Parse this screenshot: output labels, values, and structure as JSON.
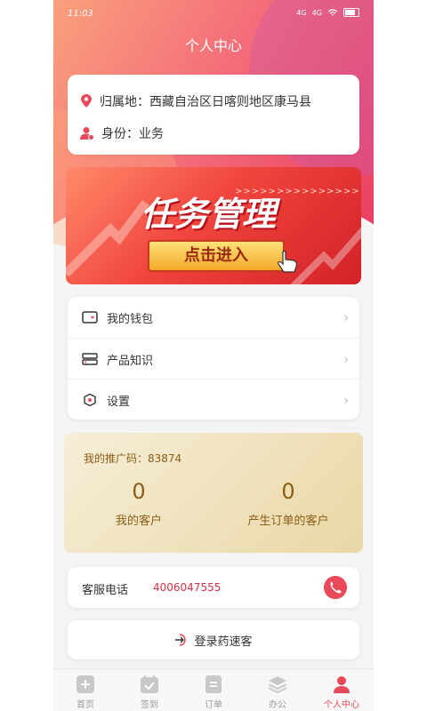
{
  "status_bar": {
    "time": "11:03",
    "net1": "4G",
    "net2": "4G"
  },
  "header": {
    "title": "个人中心"
  },
  "profile": {
    "location_label": "归属地：西藏自治区日喀则地区康马县",
    "identity_label": "身份：业务"
  },
  "banner": {
    "stripes": ">>>>>>>>>>>>>>>",
    "title": "任务管理",
    "button_label": "点击进入"
  },
  "menu": {
    "items": [
      {
        "label": "我的钱包",
        "icon": "wallet-icon"
      },
      {
        "label": "产品知识",
        "icon": "product-knowledge-icon"
      },
      {
        "label": "设置",
        "icon": "gear-icon"
      }
    ],
    "chevron": "›"
  },
  "promo": {
    "code_label": "我的推广码：83874",
    "stats": [
      {
        "value": "0",
        "label": "我的客户"
      },
      {
        "value": "0",
        "label": "产生订单的客户"
      }
    ]
  },
  "service": {
    "label": "客服电话",
    "phone": "4006047555"
  },
  "logout": {
    "label": "登录药速客"
  },
  "tabbar": {
    "tabs": [
      {
        "label": "首页",
        "icon": "home-plus-icon"
      },
      {
        "label": "签到",
        "icon": "calendar-check-icon"
      },
      {
        "label": "订单",
        "icon": "order-icon"
      },
      {
        "label": "办公",
        "icon": "layers-icon"
      },
      {
        "label": "个人中心",
        "icon": "user-icon"
      }
    ],
    "active_index": 4
  },
  "colors": {
    "accent": "#e84a5a",
    "gold_text": "#8b5e16"
  }
}
